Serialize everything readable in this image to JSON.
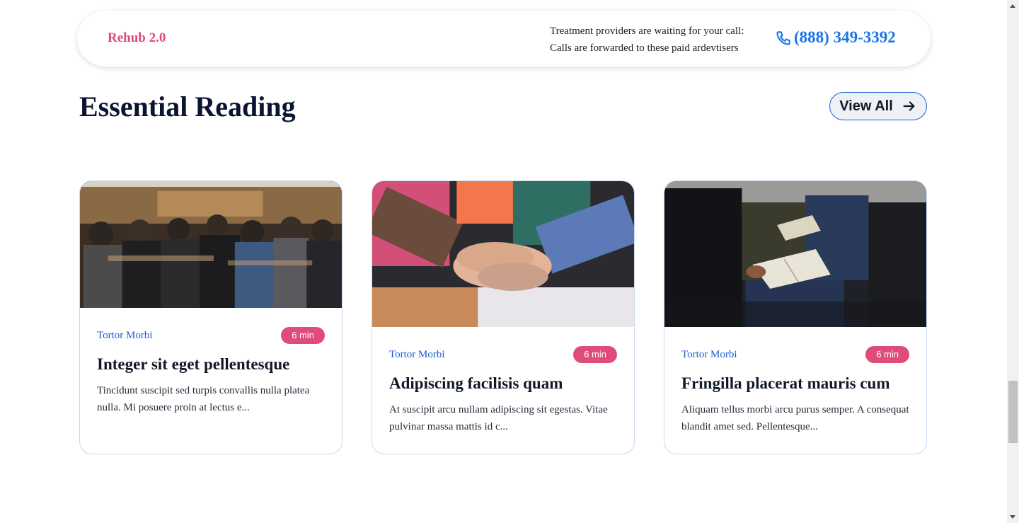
{
  "header": {
    "brand": "Rehub 2.0",
    "notice_line1": "Treatment providers are waiting for your call:",
    "notice_line2": "Calls are forwarded to these paid ardevtisers",
    "phone": "(888) 349-3392",
    "phone_icon": "phone-icon",
    "brand_color": "#e04c7a",
    "accent_color": "#1a73e8"
  },
  "section": {
    "title": "Essential Reading",
    "view_all_label": "View All",
    "view_all_icon": "arrow-right-icon"
  },
  "cards": [
    {
      "category": "Tortor Morbi",
      "read_time": "6 min",
      "title": "Integer sit eget pellentesque",
      "excerpt": "Tincidunt suscipit sed turpis convallis nulla platea nulla. Mi posuere proin at lectus e...",
      "image": "group-hug-photo"
    },
    {
      "category": "Tortor Morbi",
      "read_time": "6 min",
      "title": "Adipiscing facilisis quam",
      "excerpt": "At suscipit arcu nullam adipiscing sit egestas. Vitae pulvinar massa mattis id c...",
      "image": "stacked-hands-photo"
    },
    {
      "category": "Tortor Morbi",
      "read_time": "6 min",
      "title": "Fringilla placerat mauris cum",
      "excerpt": "Aliquam tellus morbi arcu purus semper. A consequat blandit amet sed. Pellentesque...",
      "image": "notebook-meeting-photo"
    }
  ],
  "colors": {
    "heading": "#0b1532",
    "link": "#1a5fd6",
    "badge": "#e04c7a",
    "card_border": "#c8d7f0"
  }
}
